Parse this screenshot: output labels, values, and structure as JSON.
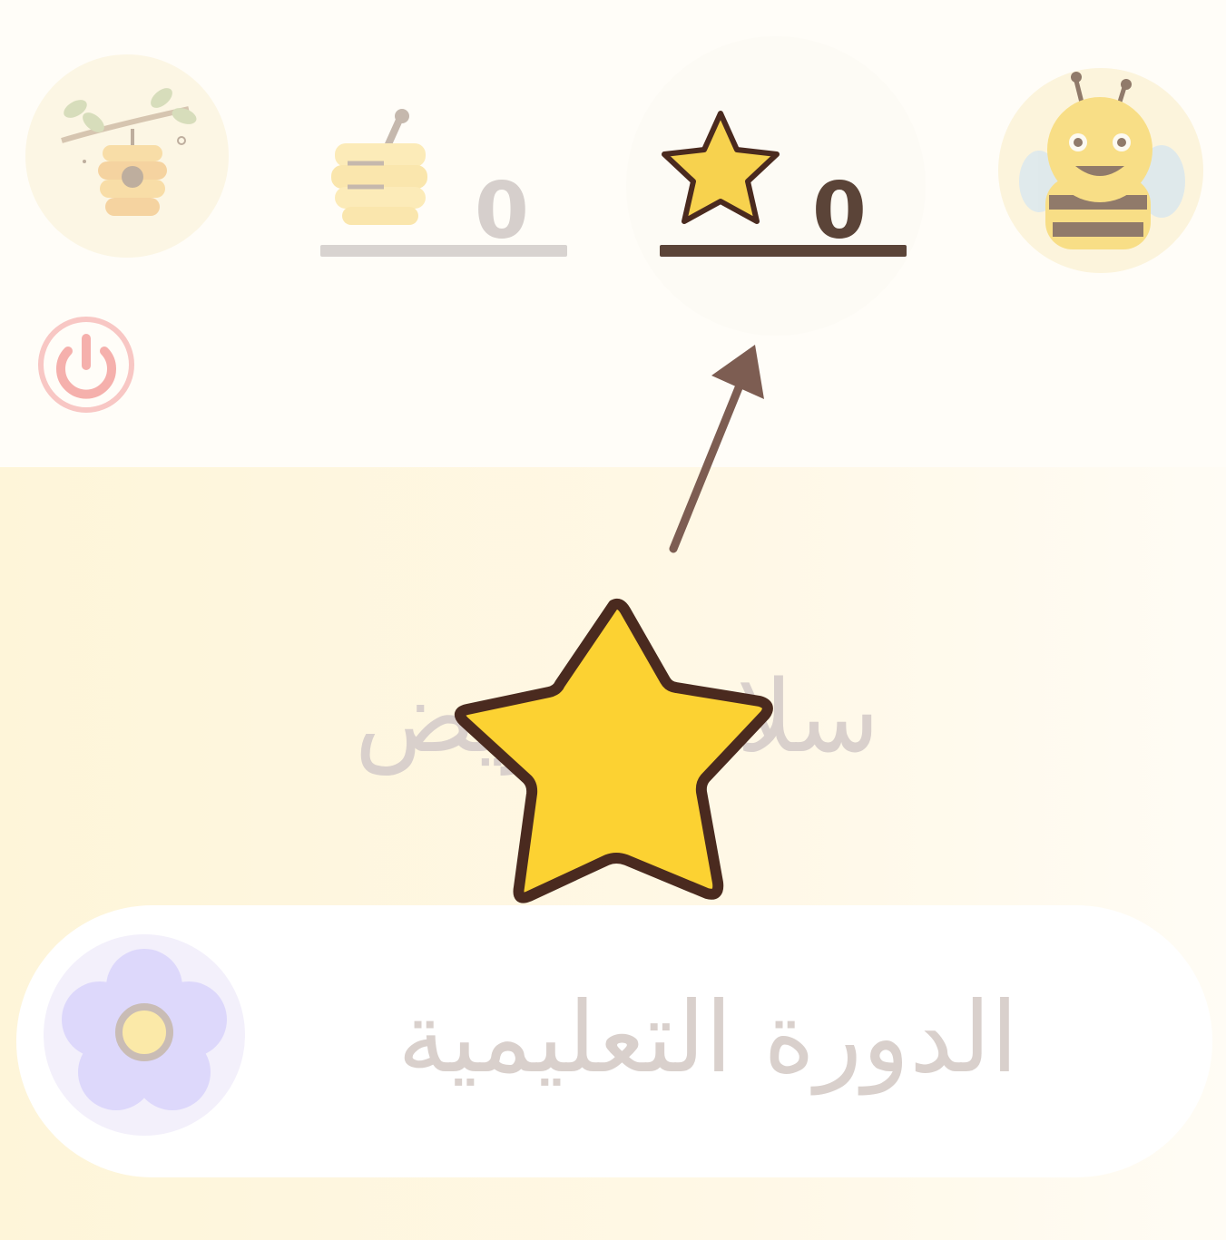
{
  "header": {
    "honey": {
      "icon": "honey-jar-icon",
      "count": "0"
    },
    "stars": {
      "icon": "star-icon",
      "count": "0"
    },
    "left_button_icon": "beehive-icon",
    "right_button_icon": "bee-avatar-icon",
    "power_icon": "power-icon"
  },
  "lesson": {
    "title": "سلام يا ريض"
  },
  "course_button": {
    "icon": "flower-icon",
    "label": "الدورة التعليمية"
  },
  "overlay": {
    "reward_icon": "star-icon",
    "pointer_icon": "arrow-icon"
  },
  "colors": {
    "star_fill": "#fcd232",
    "star_outline": "#4a2a1f",
    "brown_text": "#5b4438",
    "faded_text": "#d9d0cc",
    "power_red": "#f5b7b4",
    "flower_purple": "#d9d4f8"
  }
}
